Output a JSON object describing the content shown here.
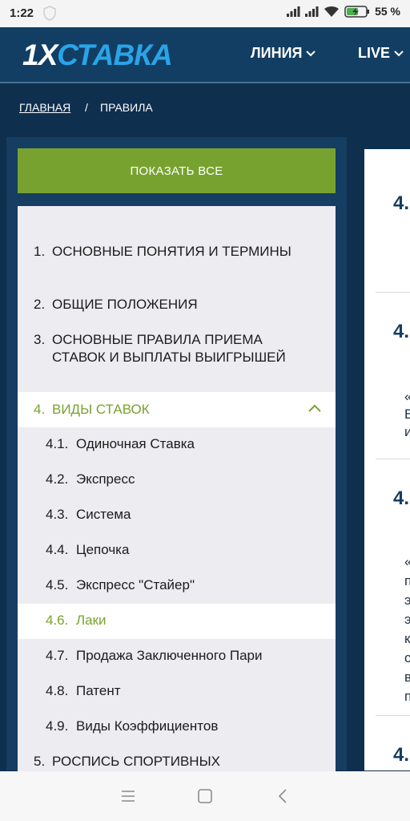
{
  "status": {
    "time": "1:22",
    "battery": "55 %"
  },
  "header": {
    "logo_part1": "1X",
    "logo_part2": "СТАВКА",
    "nav": [
      {
        "label": "ЛИНИЯ"
      },
      {
        "label": "LIVE"
      }
    ]
  },
  "breadcrumb": {
    "home": "ГЛАВНАЯ",
    "sep": "/",
    "current": "ПРАВИЛА"
  },
  "show_all": "ПОКАЗАТЬ ВСЕ",
  "menu": {
    "items": [
      {
        "num": "1.",
        "label": "ОСНОВНЫЕ ПОНЯТИЯ И ТЕРМИНЫ"
      },
      {
        "num": "2.",
        "label": "ОБЩИЕ ПОЛОЖЕНИЯ"
      },
      {
        "num": "3.",
        "label": "ОСНОВНЫЕ ПРАВИЛА ПРИЕМА СТАВОК И ВЫПЛАТЫ ВЫИГРЫШЕЙ"
      },
      {
        "num": "4.",
        "label": "ВИДЫ СТАВОК"
      },
      {
        "num": "5.",
        "label": "РОСПИСЬ СПОРТИВНЫХ"
      }
    ],
    "subitems": [
      {
        "num": "4.1.",
        "label": "Одиночная Ставка"
      },
      {
        "num": "4.2.",
        "label": "Экспресс"
      },
      {
        "num": "4.3.",
        "label": "Система"
      },
      {
        "num": "4.4.",
        "label": "Цепочка"
      },
      {
        "num": "4.5.",
        "label": "Экспресс \"Стайер\""
      },
      {
        "num": "4.6.",
        "label": "Лаки"
      },
      {
        "num": "4.7.",
        "label": "Продажа Заключенного Пари"
      },
      {
        "num": "4.8.",
        "label": "Патент"
      },
      {
        "num": "4.9.",
        "label": "Виды Коэффициентов"
      }
    ]
  },
  "content": {
    "sections": [
      "4.",
      "4.",
      "4.",
      "4."
    ],
    "fragments1": [
      "«",
      "В",
      "и"
    ],
    "fragments2": [
      "«",
      "п",
      "э",
      "э",
      "к",
      "с",
      "в",
      "п"
    ]
  },
  "colors": {
    "accent_green": "#78a22f",
    "header_bg": "#123e64",
    "page_bg": "#0f2f4f",
    "logo_blue": "#2aa4e8"
  }
}
